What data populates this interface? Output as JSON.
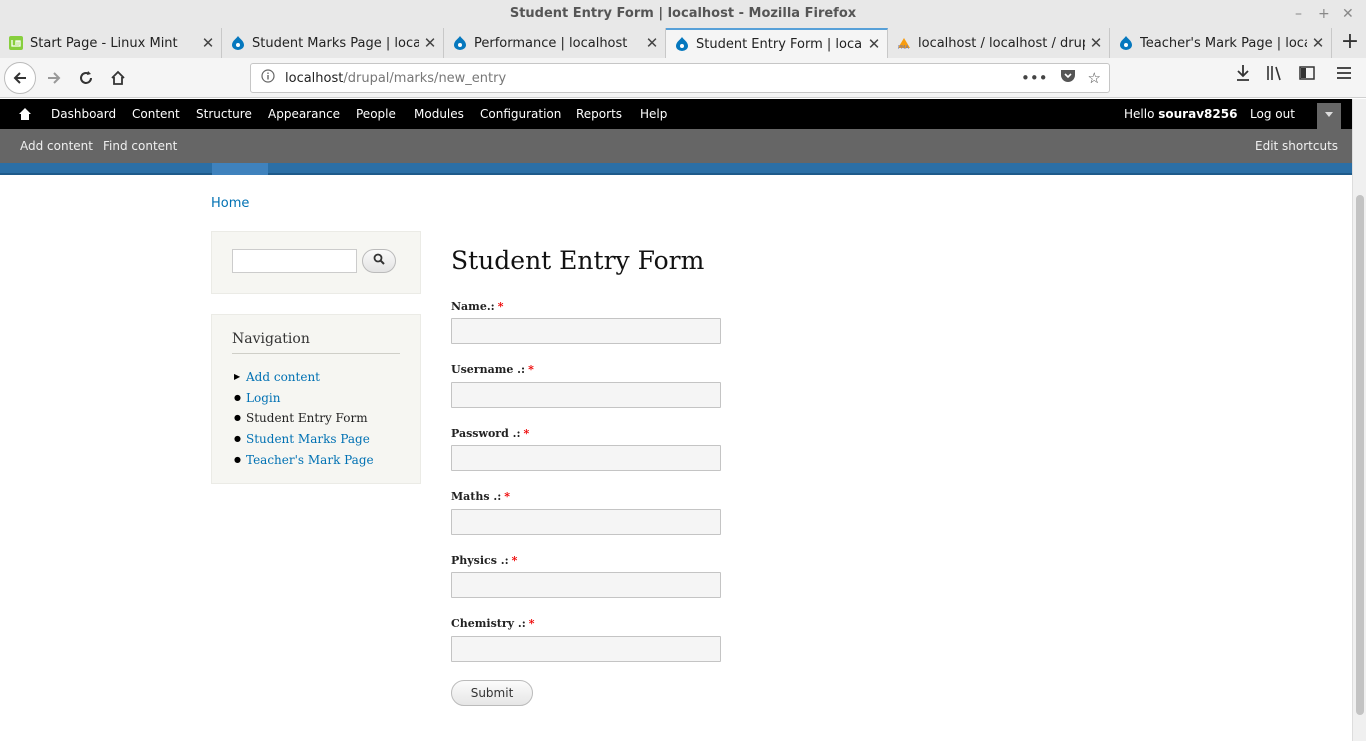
{
  "window": {
    "title": "Student Entry Form | localhost - Mozilla Firefox",
    "controls": [
      "–",
      "+",
      "✕"
    ]
  },
  "tabs": [
    {
      "label": "Start Page - Linux Mint",
      "icon": "linux-mint-icon"
    },
    {
      "label": "Student Marks Page | localho",
      "icon": "drupal-icon"
    },
    {
      "label": "Performance | localhost",
      "icon": "drupal-icon"
    },
    {
      "label": "Student Entry Form | localho",
      "icon": "drupal-icon",
      "active": true
    },
    {
      "label": "localhost / localhost / drupal",
      "icon": "phpmyadmin-icon"
    },
    {
      "label": "Teacher's Mark Page | localh",
      "icon": "drupal-icon"
    }
  ],
  "address": {
    "host": "localhost",
    "path": "/drupal/marks/new_entry"
  },
  "toolbar": {
    "items": [
      "Dashboard",
      "Content",
      "Structure",
      "Appearance",
      "People",
      "Modules",
      "Configuration",
      "Reports",
      "Help"
    ],
    "hello": "Hello",
    "username": "sourav8256",
    "logout": "Log out"
  },
  "tray": {
    "add_content": "Add content",
    "find_content": "Find content",
    "edit_shortcuts": "Edit shortcuts"
  },
  "breadcrumb": "Home",
  "navigation": {
    "heading": "Navigation",
    "items": [
      {
        "label": "Add content",
        "link": true,
        "bullet": "▶"
      },
      {
        "label": "Login",
        "link": true,
        "bullet": "●"
      },
      {
        "label": "Student Entry Form",
        "link": false,
        "bullet": "●"
      },
      {
        "label": "Student Marks Page",
        "link": true,
        "bullet": "●"
      },
      {
        "label": "Teacher's Mark Page",
        "link": true,
        "bullet": "●"
      }
    ]
  },
  "form": {
    "title": "Student Entry Form",
    "required_marker": "*",
    "fields": [
      {
        "label": "Name.:",
        "value": ""
      },
      {
        "label": "Username .:",
        "value": ""
      },
      {
        "label": "Password .:",
        "value": ""
      },
      {
        "label": "Maths .:",
        "value": ""
      },
      {
        "label": "Physics .:",
        "value": ""
      },
      {
        "label": "Chemistry .:",
        "value": ""
      }
    ],
    "submit": "Submit"
  },
  "colors": {
    "link": "#0071b3",
    "required": "#ee0000",
    "toolbar": "#000000",
    "tray": "#666666"
  }
}
